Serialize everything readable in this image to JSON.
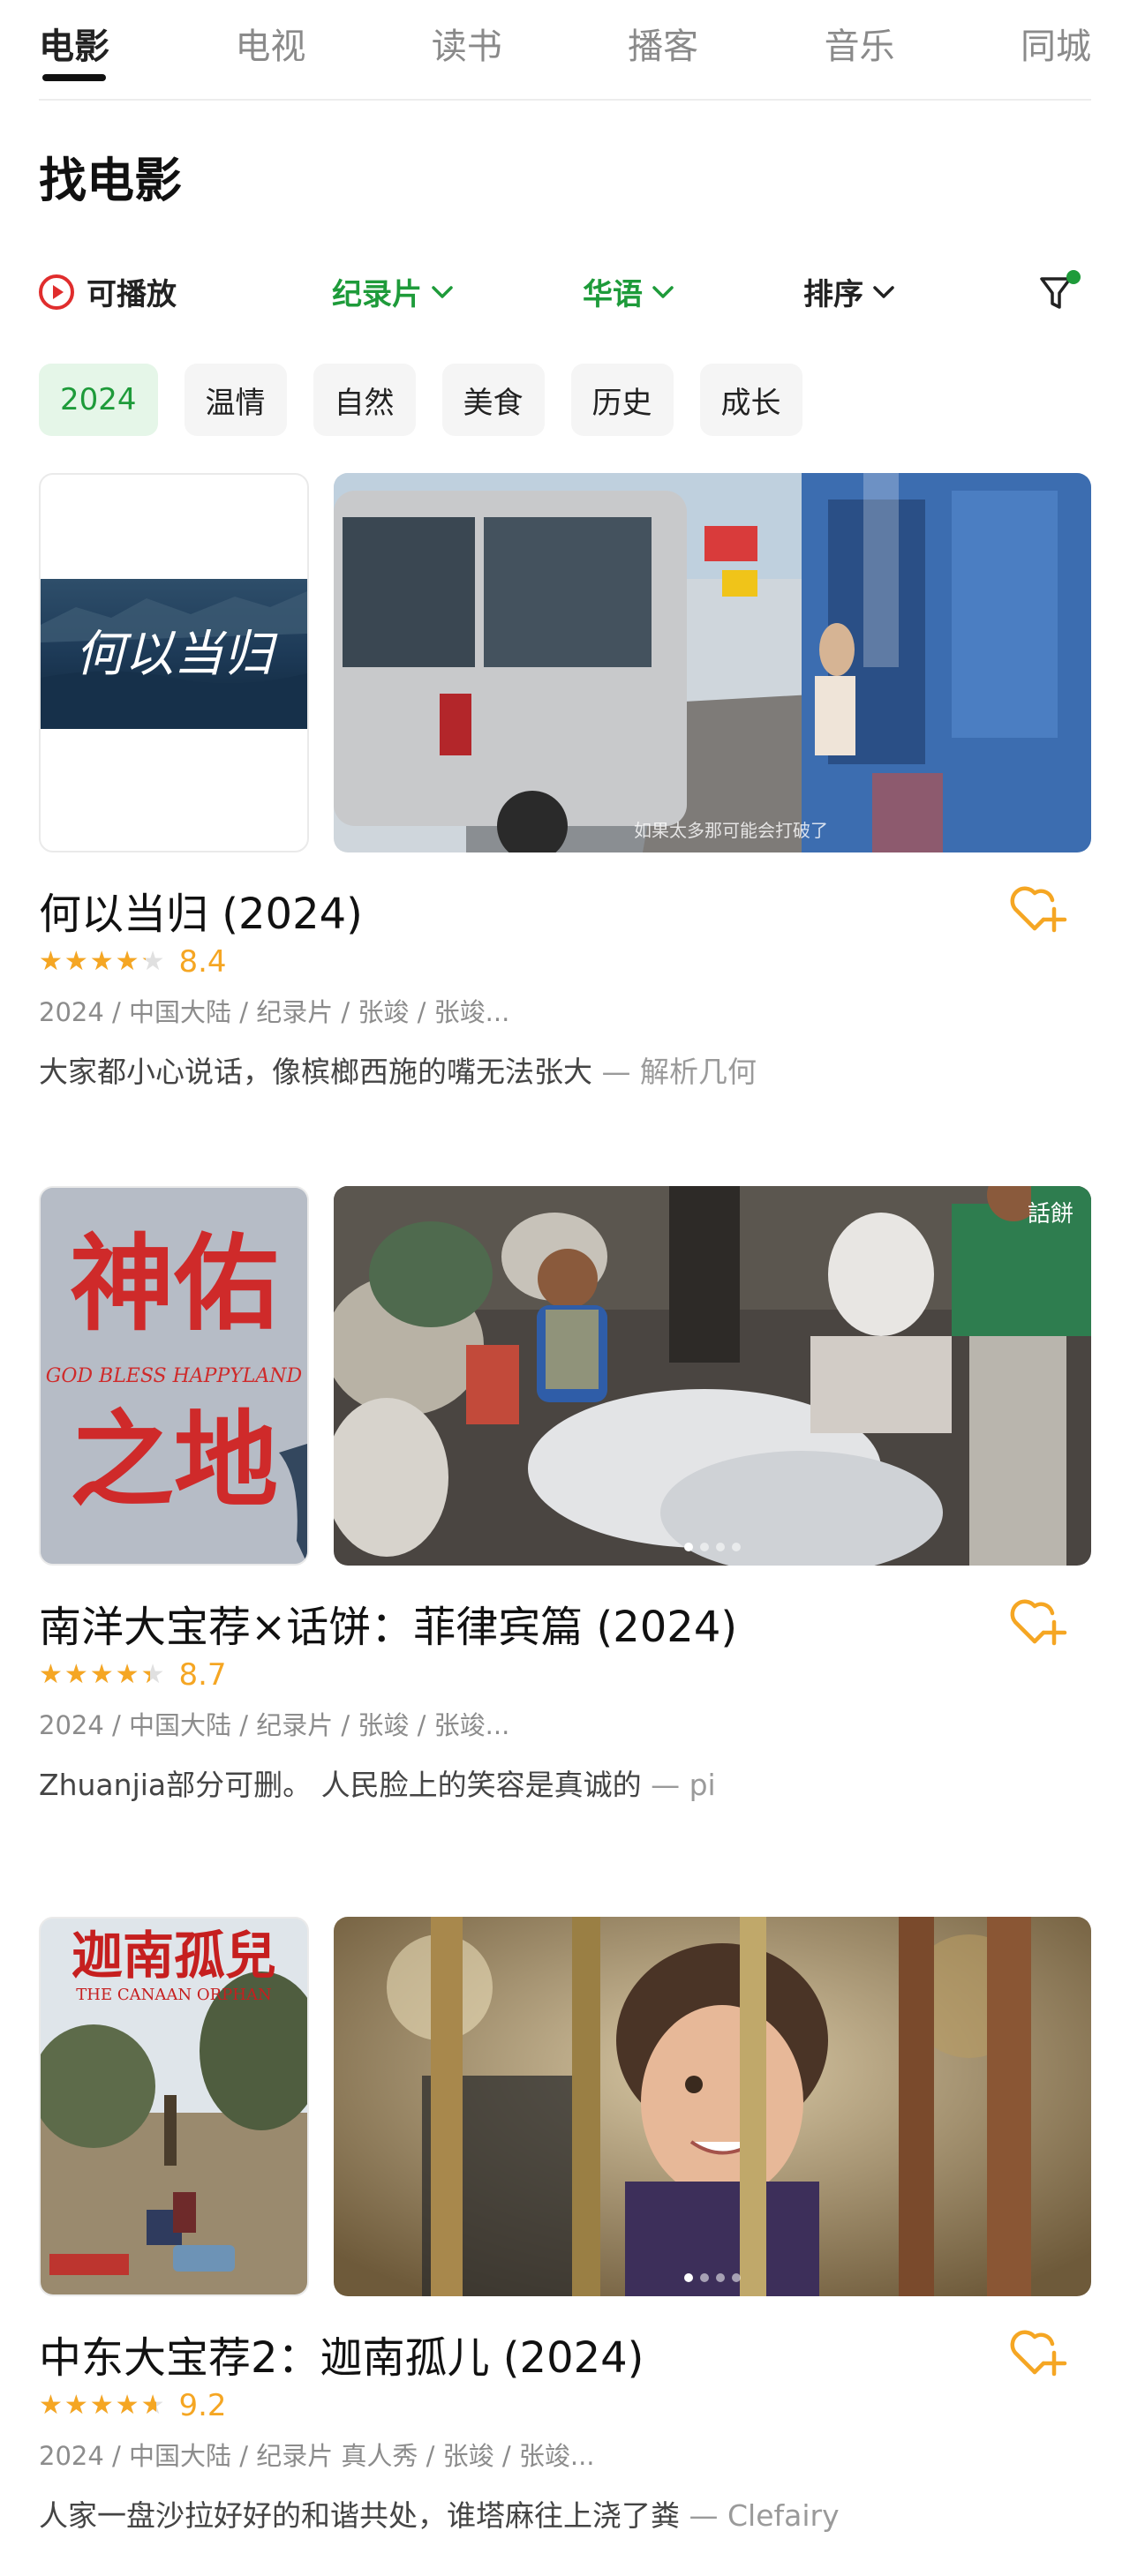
{
  "tabs": [
    {
      "label": "电影",
      "active": true
    },
    {
      "label": "电视",
      "active": false
    },
    {
      "label": "读书",
      "active": false
    },
    {
      "label": "播客",
      "active": false
    },
    {
      "label": "音乐",
      "active": false
    },
    {
      "label": "同城",
      "active": false
    }
  ],
  "page_title": "找电影",
  "filters": {
    "playable_label": "可播放",
    "genre_label": "纪录片",
    "language_label": "华语",
    "sort_label": "排序",
    "filter_icon": "funnel-icon",
    "accent_color": "#1e9b3a"
  },
  "tags": [
    {
      "label": "2024",
      "active": true
    },
    {
      "label": "温情",
      "active": false
    },
    {
      "label": "自然",
      "active": false
    },
    {
      "label": "美食",
      "active": false
    },
    {
      "label": "历史",
      "active": false
    },
    {
      "label": "成长",
      "active": false
    }
  ],
  "items": [
    {
      "title": "何以当归 (2024)",
      "poster_text": "何以当归",
      "still_caption": "如果太多那可能会打破了",
      "rating": 4.2,
      "score": "8.4",
      "meta": "2024 / 中国大陆 / 纪录片 / 张竣 / 张竣...",
      "comment": "大家都小心说话，像槟榔西施的嘴无法张大",
      "author": " — 解析几何",
      "carousel_dots": 0
    },
    {
      "title": "南洋大宝荐×话饼：菲律宾篇 (2024)",
      "poster_text_1": "神佑",
      "poster_subtitle": "GOD BLESS HAPPYLAND",
      "poster_text_2": "之地",
      "still_badge": "話餅",
      "rating": 4.35,
      "score": "8.7",
      "meta": "2024 / 中国大陆 / 纪录片 / 张竣 / 张竣...",
      "comment": "Zhuanjia部分可删。 人民脸上的笑容是真诚的",
      "author": " — pi",
      "carousel_dots": 4
    },
    {
      "title": "中东大宝荐2：迦南孤儿 (2024)",
      "poster_text": "迦南孤兒",
      "poster_subtitle": "THE CANAAN ORPHAN",
      "rating": 4.6,
      "score": "9.2",
      "meta": "2024 / 中国大陆 / 纪录片 真人秀 / 张竣 / 张竣...",
      "comment": "人家一盘沙拉好好的和谐共处，谁塔麻往上浇了粪",
      "author": " — Clefairy",
      "carousel_dots": 4
    }
  ],
  "colors": {
    "star": "#f5a623",
    "play_red": "#e02d2d",
    "fav_orange": "#f5a623"
  }
}
